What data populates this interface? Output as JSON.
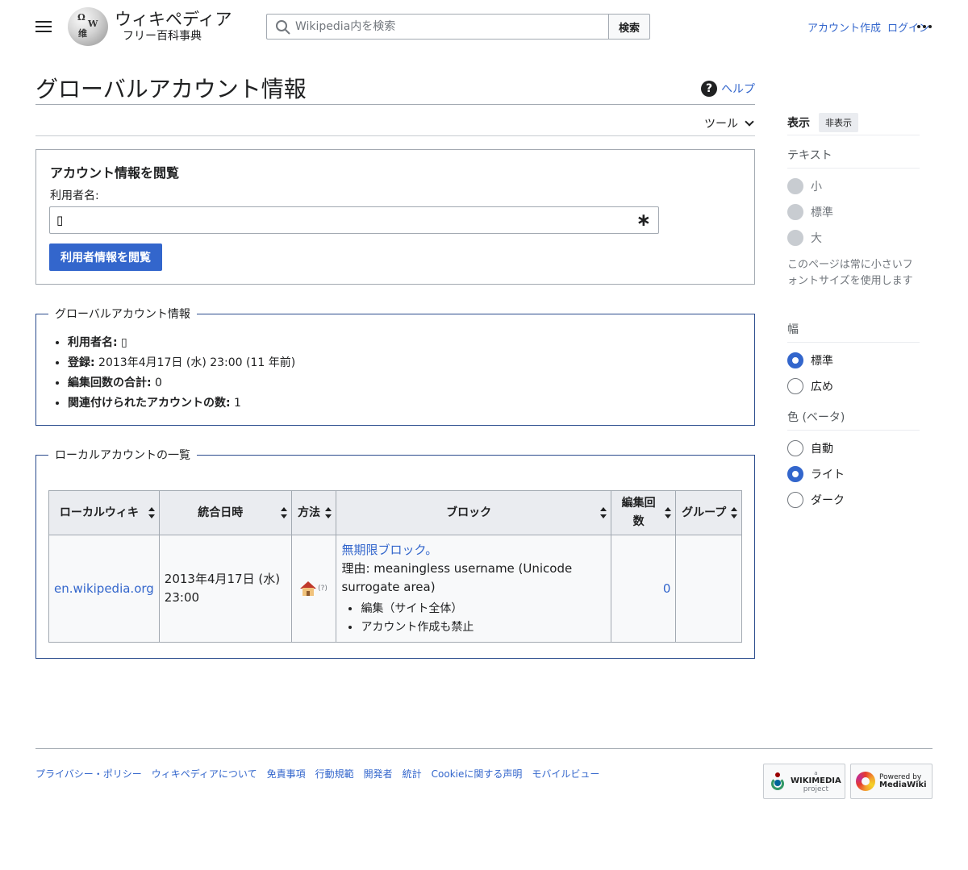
{
  "header": {
    "logo_wordmark": "ウィキペディア",
    "logo_tagline": "フリー百科事典",
    "globe_glyphs": [
      "Ω",
      "W",
      "维"
    ],
    "search_placeholder": "Wikipedia内を検索",
    "search_button": "検索",
    "create_account": "アカウント作成",
    "login": "ログイン"
  },
  "page": {
    "title": "グローバルアカウント情報",
    "help": "ヘルプ",
    "tools": "ツール"
  },
  "lookup": {
    "heading": "アカウント情報を閲覧",
    "username_label": "利用者名:",
    "username_value": "▯",
    "required_mark": "∗",
    "submit": "利用者情報を閲覧"
  },
  "global_info": {
    "legend": "グローバルアカウント情報",
    "items": [
      {
        "label": "利用者名:",
        "value": " ▯"
      },
      {
        "label": "登録:",
        "value": " 2013年4月17日 (水) 23:00 (11 年前)"
      },
      {
        "label": "編集回数の合計:",
        "value": " 0"
      },
      {
        "label": "関連付けられたアカウントの数:",
        "value": " 1"
      }
    ]
  },
  "local_accounts": {
    "legend": "ローカルアカウントの一覧",
    "headers": [
      "ローカルウィキ",
      "統合日時",
      "方法",
      "ブロック",
      "編集回数",
      "グループ"
    ],
    "rows": [
      {
        "wiki": "en.wikipedia.org",
        "attached": "2013年4月17日 (水) 23:00",
        "method_icon": "home-icon",
        "method_help": "(?)",
        "block_link": "無期限ブロック。",
        "block_reason": "理由: meaningless username (Unicode surrogate area)",
        "block_flags": [
          "編集（サイト全体）",
          "アカウント作成も禁止"
        ],
        "edits": "0",
        "groups": ""
      }
    ]
  },
  "sidebar": {
    "title": "表示",
    "hide": "非表示",
    "text_section": "テキスト",
    "text_options": [
      "小",
      "標準",
      "大"
    ],
    "text_note": "このページは常に小さいフォントサイズを使用します",
    "width_section": "幅",
    "width_options": [
      "標準",
      "広め"
    ],
    "width_selected": "標準",
    "color_section": "色 (ベータ)",
    "color_options": [
      "自動",
      "ライト",
      "ダーク"
    ],
    "color_selected": "ライト"
  },
  "footer": {
    "links": [
      "プライバシー・ポリシー",
      "ウィキペディアについて",
      "免責事項",
      "行動規範",
      "開発者",
      "統計",
      "Cookieに関する声明",
      "モバイルビュー"
    ],
    "wikimedia_badge": {
      "line1": "a",
      "line2": "WIKIMEDIA",
      "line3": "project"
    },
    "mediawiki_badge": {
      "line1": "Powered by",
      "line2": "MediaWiki"
    }
  },
  "colors": {
    "accent": "#3366cc",
    "fieldset_border": "#2a4b8d",
    "table_header": "#eaecf0"
  }
}
